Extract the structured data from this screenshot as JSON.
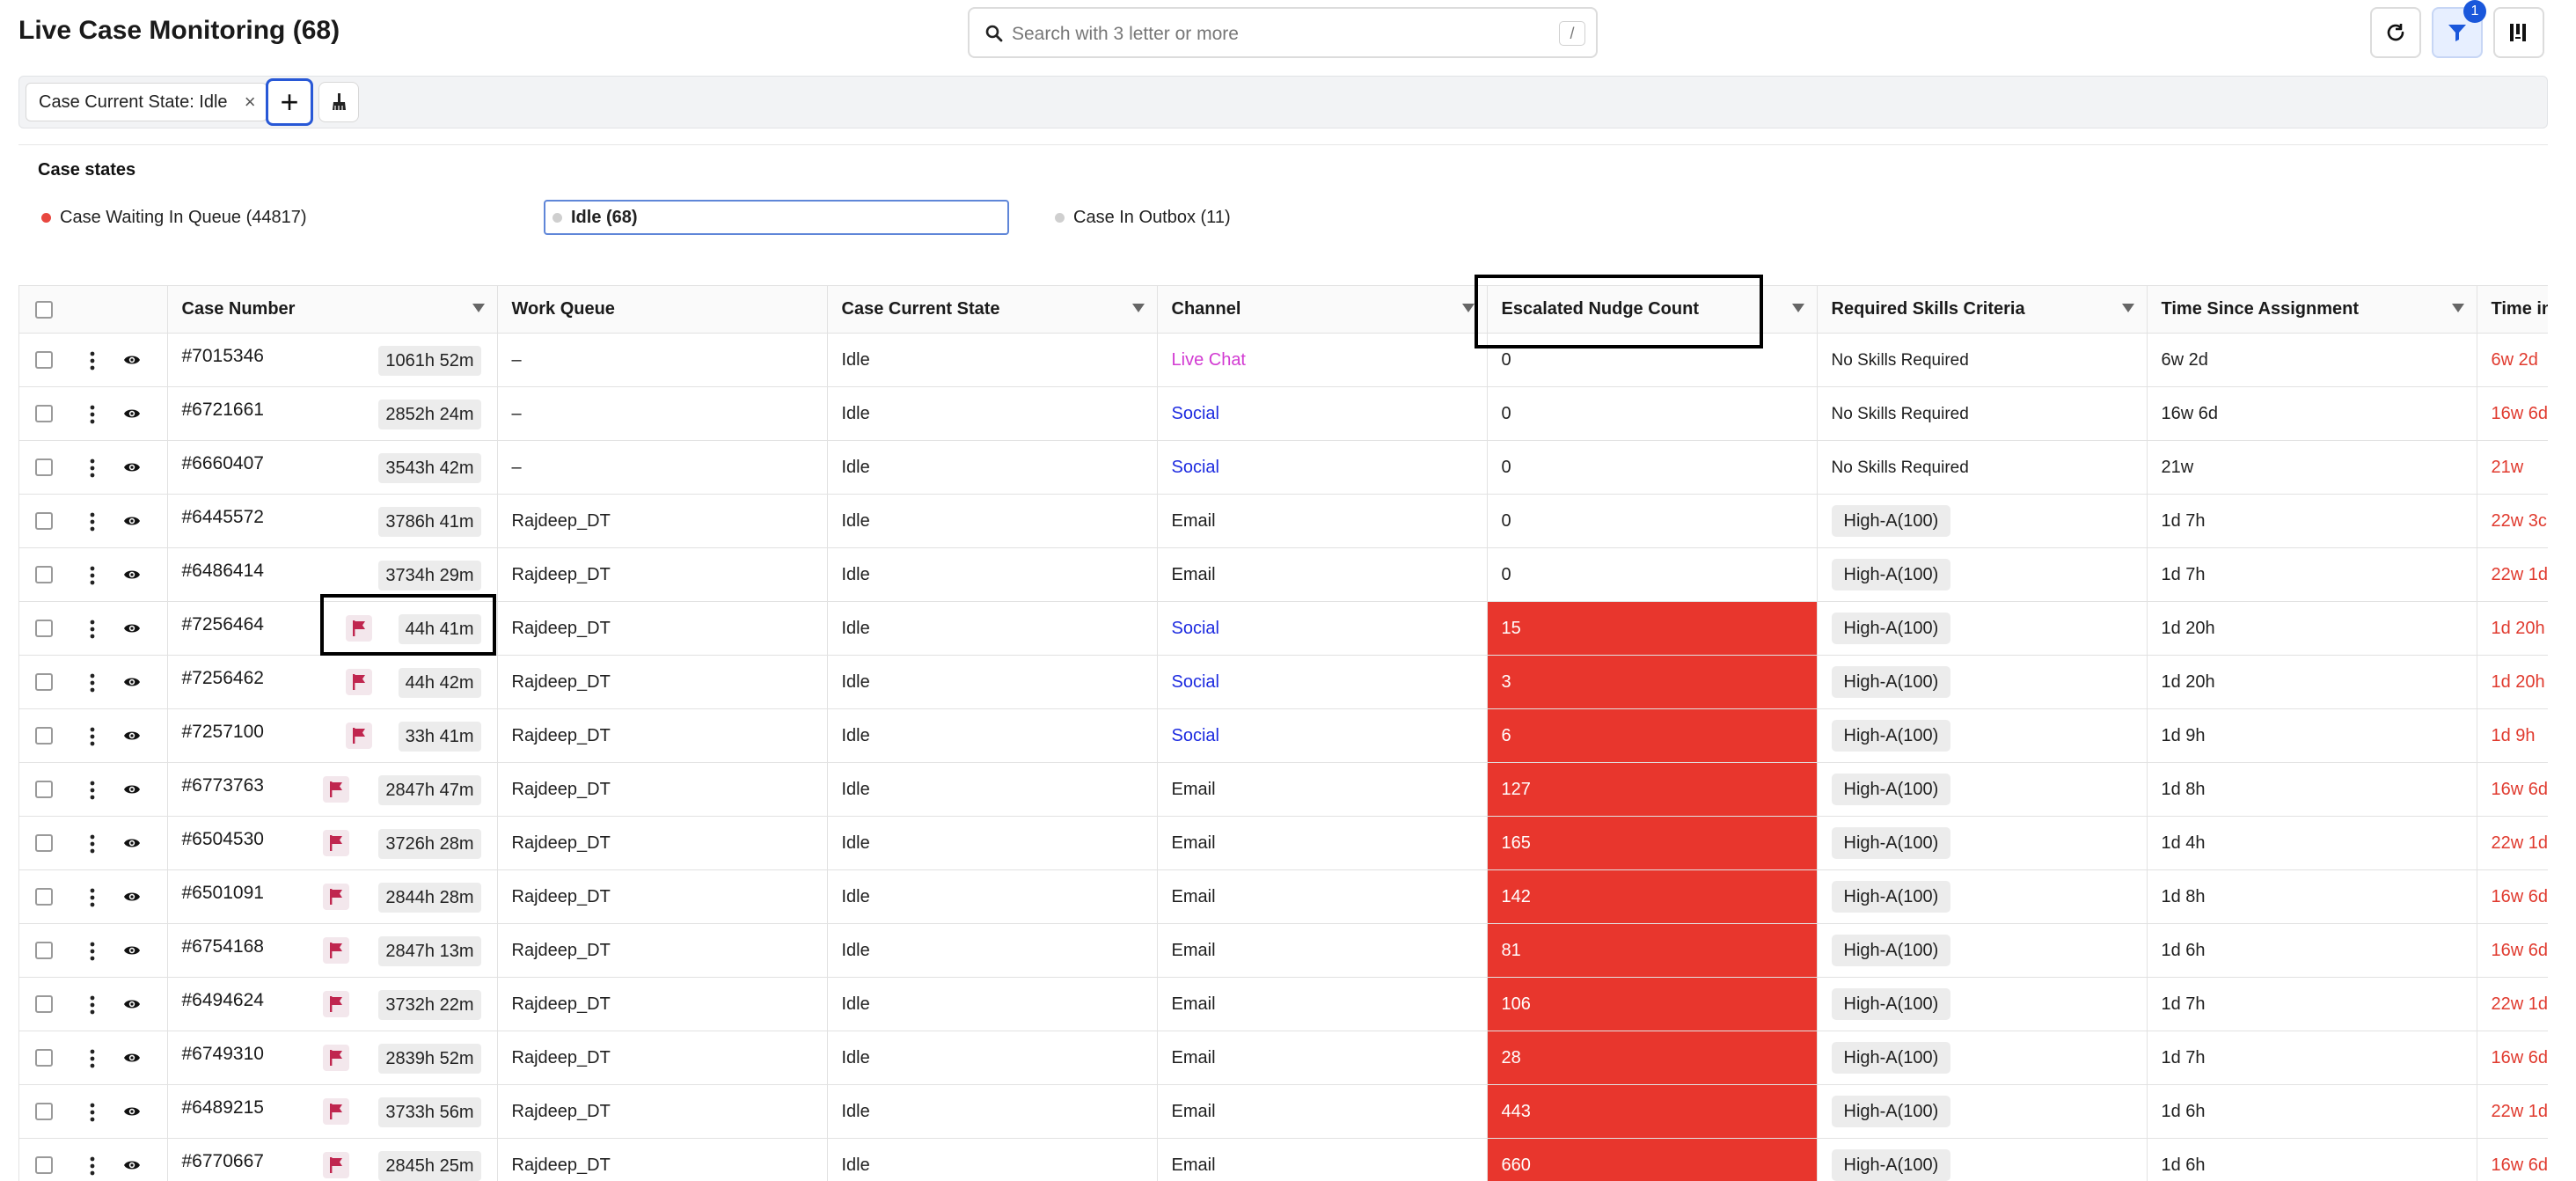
{
  "header": {
    "title": "Live Case Monitoring (68)",
    "search_placeholder": "Search with 3 letter or more",
    "search_shortcut": "/",
    "filter_badge": "1"
  },
  "filterbar": {
    "chip_label": "Case Current State: Idle",
    "chip_close": "×",
    "add_label": "+"
  },
  "states": {
    "title": "Case states",
    "items": [
      {
        "label": "Case Waiting In Queue (44817)",
        "color": "#e8473f"
      },
      {
        "label": "Idle (68)",
        "color": "#cfcfcf"
      },
      {
        "label": "Case In Outbox (11)",
        "color": "#cfcfcf"
      }
    ]
  },
  "table": {
    "columns": [
      "Case Number",
      "Work Queue",
      "Case Current State",
      "Channel",
      "Escalated Nudge Count",
      "Required Skills Criteria",
      "Time Since Assignment",
      "Time in"
    ],
    "rows": [
      {
        "case": "#7015346",
        "timer": "1061h 52m",
        "flag": false,
        "queue": "–",
        "state": "Idle",
        "channel": "Live Chat",
        "nudge": "0",
        "skill": "No Skills Required",
        "since": "6w 2d",
        "timein": "6w 2d"
      },
      {
        "case": "#6721661",
        "timer": "2852h 24m",
        "flag": false,
        "queue": "–",
        "state": "Idle",
        "channel": "Social",
        "nudge": "0",
        "skill": "No Skills Required",
        "since": "16w 6d",
        "timein": "16w 6d"
      },
      {
        "case": "#6660407",
        "timer": "3543h 42m",
        "flag": false,
        "queue": "–",
        "state": "Idle",
        "channel": "Social",
        "nudge": "0",
        "skill": "No Skills Required",
        "since": "21w",
        "timein": "21w"
      },
      {
        "case": "#6445572",
        "timer": "3786h 41m",
        "flag": false,
        "queue": "Rajdeep_DT",
        "state": "Idle",
        "channel": "Email",
        "nudge": "0",
        "skill": "High-A(100)",
        "since": "1d 7h",
        "timein": "22w 3c"
      },
      {
        "case": "#6486414",
        "timer": "3734h 29m",
        "flag": false,
        "queue": "Rajdeep_DT",
        "state": "Idle",
        "channel": "Email",
        "nudge": "0",
        "skill": "High-A(100)",
        "since": "1d 7h",
        "timein": "22w 1d"
      },
      {
        "case": "#7256464",
        "timer": "44h 41m",
        "flag": true,
        "queue": "Rajdeep_DT",
        "state": "Idle",
        "channel": "Social",
        "nudge": "15",
        "skill": "High-A(100)",
        "since": "1d 20h",
        "timein": "1d 20h"
      },
      {
        "case": "#7256462",
        "timer": "44h 42m",
        "flag": true,
        "queue": "Rajdeep_DT",
        "state": "Idle",
        "channel": "Social",
        "nudge": "3",
        "skill": "High-A(100)",
        "since": "1d 20h",
        "timein": "1d 20h"
      },
      {
        "case": "#7257100",
        "timer": "33h 41m",
        "flag": true,
        "queue": "Rajdeep_DT",
        "state": "Idle",
        "channel": "Social",
        "nudge": "6",
        "skill": "High-A(100)",
        "since": "1d 9h",
        "timein": "1d 9h"
      },
      {
        "case": "#6773763",
        "timer": "2847h 47m",
        "flag": true,
        "queue": "Rajdeep_DT",
        "state": "Idle",
        "channel": "Email",
        "nudge": "127",
        "skill": "High-A(100)",
        "since": "1d 8h",
        "timein": "16w 6d"
      },
      {
        "case": "#6504530",
        "timer": "3726h 28m",
        "flag": true,
        "queue": "Rajdeep_DT",
        "state": "Idle",
        "channel": "Email",
        "nudge": "165",
        "skill": "High-A(100)",
        "since": "1d 4h",
        "timein": "22w 1d"
      },
      {
        "case": "#6501091",
        "timer": "2844h 28m",
        "flag": true,
        "queue": "Rajdeep_DT",
        "state": "Idle",
        "channel": "Email",
        "nudge": "142",
        "skill": "High-A(100)",
        "since": "1d 8h",
        "timein": "16w 6d"
      },
      {
        "case": "#6754168",
        "timer": "2847h 13m",
        "flag": true,
        "queue": "Rajdeep_DT",
        "state": "Idle",
        "channel": "Email",
        "nudge": "81",
        "skill": "High-A(100)",
        "since": "1d 6h",
        "timein": "16w 6d"
      },
      {
        "case": "#6494624",
        "timer": "3732h 22m",
        "flag": true,
        "queue": "Rajdeep_DT",
        "state": "Idle",
        "channel": "Email",
        "nudge": "106",
        "skill": "High-A(100)",
        "since": "1d 7h",
        "timein": "22w 1d"
      },
      {
        "case": "#6749310",
        "timer": "2839h 52m",
        "flag": true,
        "queue": "Rajdeep_DT",
        "state": "Idle",
        "channel": "Email",
        "nudge": "28",
        "skill": "High-A(100)",
        "since": "1d 7h",
        "timein": "16w 6d"
      },
      {
        "case": "#6489215",
        "timer": "3733h 56m",
        "flag": true,
        "queue": "Rajdeep_DT",
        "state": "Idle",
        "channel": "Email",
        "nudge": "443",
        "skill": "High-A(100)",
        "since": "1d 6h",
        "timein": "22w 1d"
      },
      {
        "case": "#6770667",
        "timer": "2845h 25m",
        "flag": true,
        "queue": "Rajdeep_DT",
        "state": "Idle",
        "channel": "Email",
        "nudge": "660",
        "skill": "High-A(100)",
        "since": "1d 6h",
        "timein": "16w 6d"
      }
    ]
  }
}
